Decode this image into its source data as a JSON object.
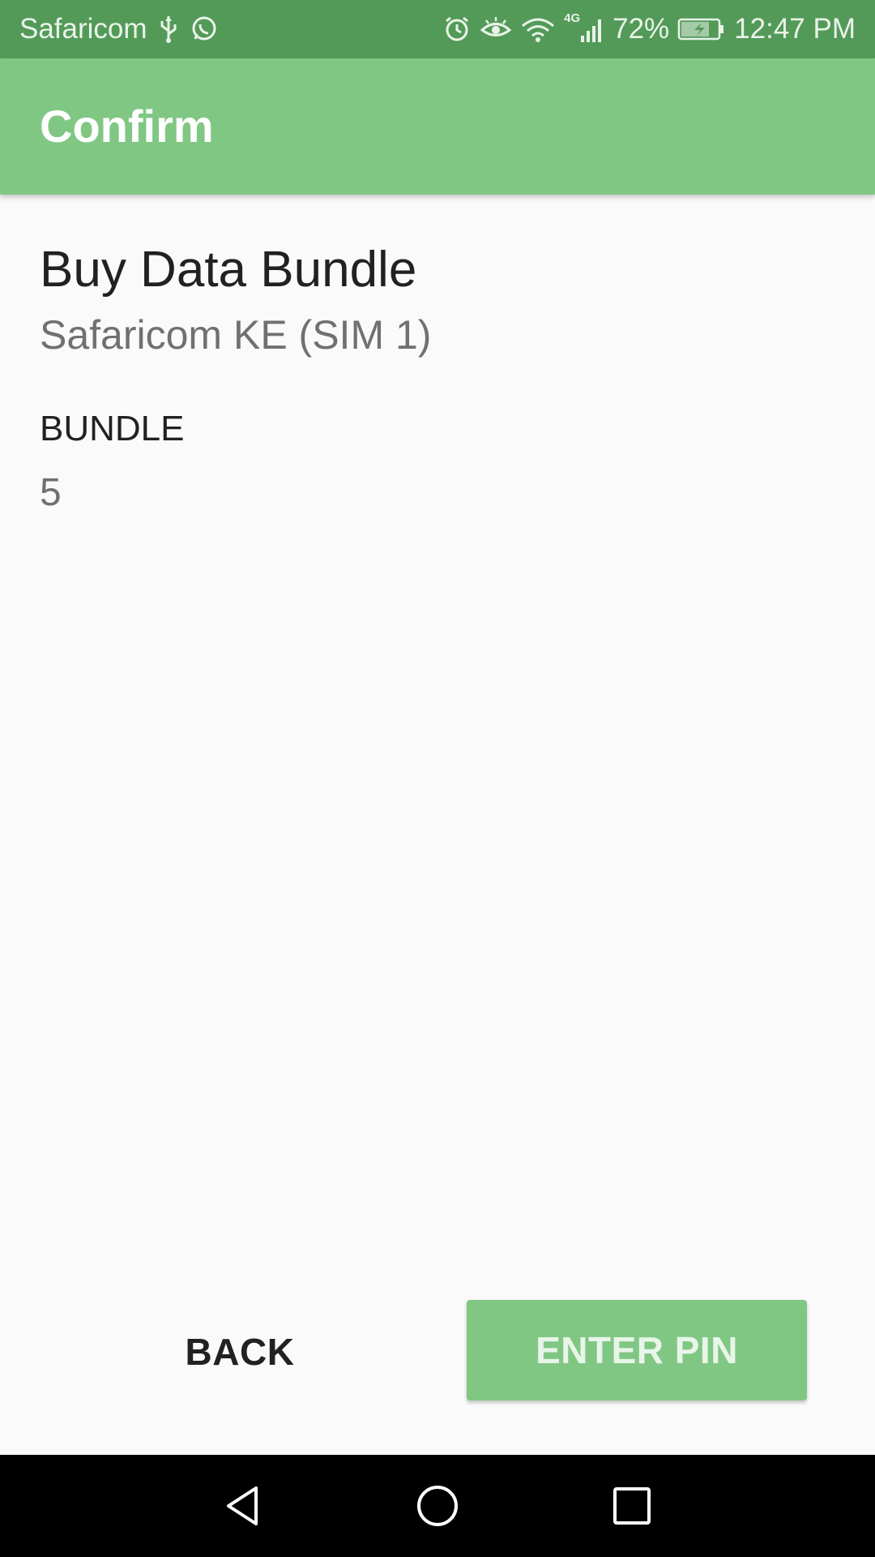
{
  "status_bar": {
    "carrier": "Safaricom",
    "network_type": "4G",
    "battery_percent": "72%",
    "time": "12:47 PM",
    "icons": [
      "usb-icon",
      "whatsapp-icon",
      "alarm-icon",
      "eye-comfort-icon",
      "wifi-icon",
      "signal-icon",
      "battery-charging-icon"
    ]
  },
  "app_bar": {
    "title": "Confirm"
  },
  "content": {
    "heading": "Buy Data Bundle",
    "subheading": "Safaricom KE (SIM 1)",
    "field_label": "BUNDLE",
    "field_value": "5"
  },
  "actions": {
    "back_label": "BACK",
    "enter_pin_label": "ENTER PIN"
  },
  "nav_bar": {
    "icons": [
      "back-triangle-icon",
      "home-circle-icon",
      "recents-square-icon"
    ]
  },
  "colors": {
    "status_bar": "#539a58",
    "app_bar": "#81c784",
    "primary_button": "#81c784",
    "background": "#fafafa"
  }
}
